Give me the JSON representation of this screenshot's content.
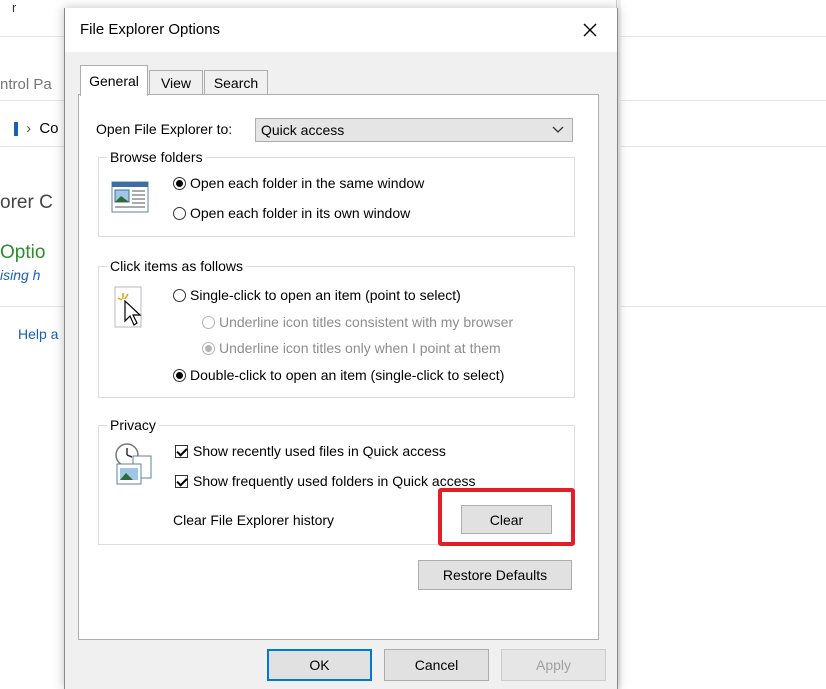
{
  "background": {
    "title_fragment": "r",
    "address_fragment": "ntrol Pa",
    "breadcrumb_fragment": "Co",
    "heading_fragment": "orer C",
    "options_fragment": "Optio",
    "subtitle_fragment": "ising h",
    "help_fragment": "Help a"
  },
  "dialog": {
    "title": "File Explorer Options",
    "tabs": [
      {
        "label": "General",
        "active": true
      },
      {
        "label": "View",
        "active": false
      },
      {
        "label": "Search",
        "active": false
      }
    ],
    "open_to_label": "Open File Explorer to:",
    "open_to_value": "Quick access",
    "browse": {
      "legend": "Browse folders",
      "options": [
        {
          "label": "Open each folder in the same window",
          "selected": true
        },
        {
          "label": "Open each folder in its own window",
          "selected": false
        }
      ]
    },
    "click": {
      "legend": "Click items as follows",
      "single": {
        "label": "Single-click to open an item (point to select)",
        "selected": false
      },
      "underline_browser": {
        "label": "Underline icon titles consistent with my browser",
        "selected": false
      },
      "underline_point": {
        "label": "Underline icon titles only when I point at them",
        "selected": true
      },
      "double": {
        "label": "Double-click to open an item (single-click to select)",
        "selected": true
      }
    },
    "privacy": {
      "legend": "Privacy",
      "recent_files": {
        "label": "Show recently used files in Quick access",
        "checked": true
      },
      "frequent_folders": {
        "label": "Show frequently used folders in Quick access",
        "checked": true
      },
      "clear_history_label": "Clear File Explorer history",
      "clear_button": "Clear"
    },
    "restore_defaults": "Restore Defaults",
    "ok": "OK",
    "cancel": "Cancel",
    "apply": "Apply"
  },
  "colors": {
    "highlight": "#e41e26",
    "default_button_border": "#0078d7",
    "panel_background": "#f0f0f0"
  }
}
